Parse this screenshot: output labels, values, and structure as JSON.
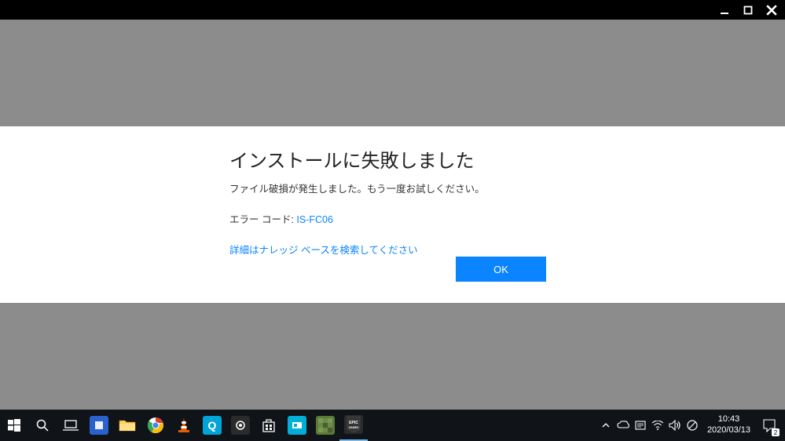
{
  "titlebar": {
    "minimize": "minimize",
    "maximize": "maximize",
    "close": "close"
  },
  "dialog": {
    "title": "インストールに失敗しました",
    "subtitle": "ファイル破損が発生しました。もう一度お試しください。",
    "error_label": "エラー コード: ",
    "error_code": "IS-FC06",
    "kb_link": "詳細はナレッジ ベースを検索してください",
    "ok": "OK"
  },
  "taskbar": {
    "apps": [
      {
        "name": "start",
        "color": "#fff"
      },
      {
        "name": "search",
        "color": "#fff"
      },
      {
        "name": "task-view",
        "color": "#fff"
      },
      {
        "name": "app-blue-square",
        "color": "#2962cc"
      },
      {
        "name": "file-explorer",
        "color": "#ffcc33"
      },
      {
        "name": "chrome",
        "color": "#fff"
      },
      {
        "name": "vlc",
        "color": "#e85d00"
      },
      {
        "name": "app-teal-q",
        "color": "#00a4d8",
        "letter": "Q"
      },
      {
        "name": "settings-app",
        "color": "#2b2b2b"
      },
      {
        "name": "microsoft-store",
        "color": "#fff"
      },
      {
        "name": "app-cyan",
        "color": "#00aed6"
      },
      {
        "name": "minecraft",
        "color": "#5a7a3a"
      },
      {
        "name": "epic-games",
        "color": "#2b2b2b",
        "letter": "EPIC"
      }
    ],
    "tray": {
      "chevron": "^",
      "time": "10:43",
      "date": "2020/03/13",
      "notif_count": "2"
    }
  }
}
